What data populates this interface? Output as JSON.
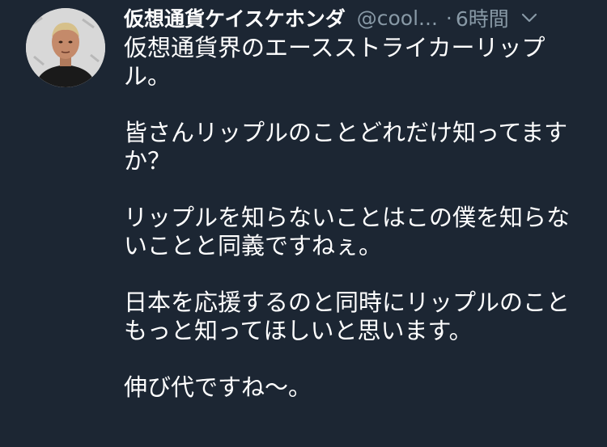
{
  "tweet": {
    "author_name": "仮想通貨ケイスケホンダ",
    "handle": "@cool...",
    "separator": "·",
    "time": "6時間",
    "icons": {
      "avatar": "profile-photo",
      "chevron": "chevron-down-icon"
    },
    "paragraphs": [
      "仮想通貨界のエースストライカーリップ\nル。",
      "皆さんリップルのことどれだけ知ってます\nか？",
      "リップルを知らないことはこの僕を知らな\nいことと同義ですねぇ。",
      "日本を応援するのと同時にリップルのこと\nもっと知ってほしいと思います。",
      "伸び代ですね〜。"
    ]
  },
  "colors": {
    "background": "#1c2633",
    "secondary_text": "#8899a6",
    "primary_text": "#ffffff"
  }
}
